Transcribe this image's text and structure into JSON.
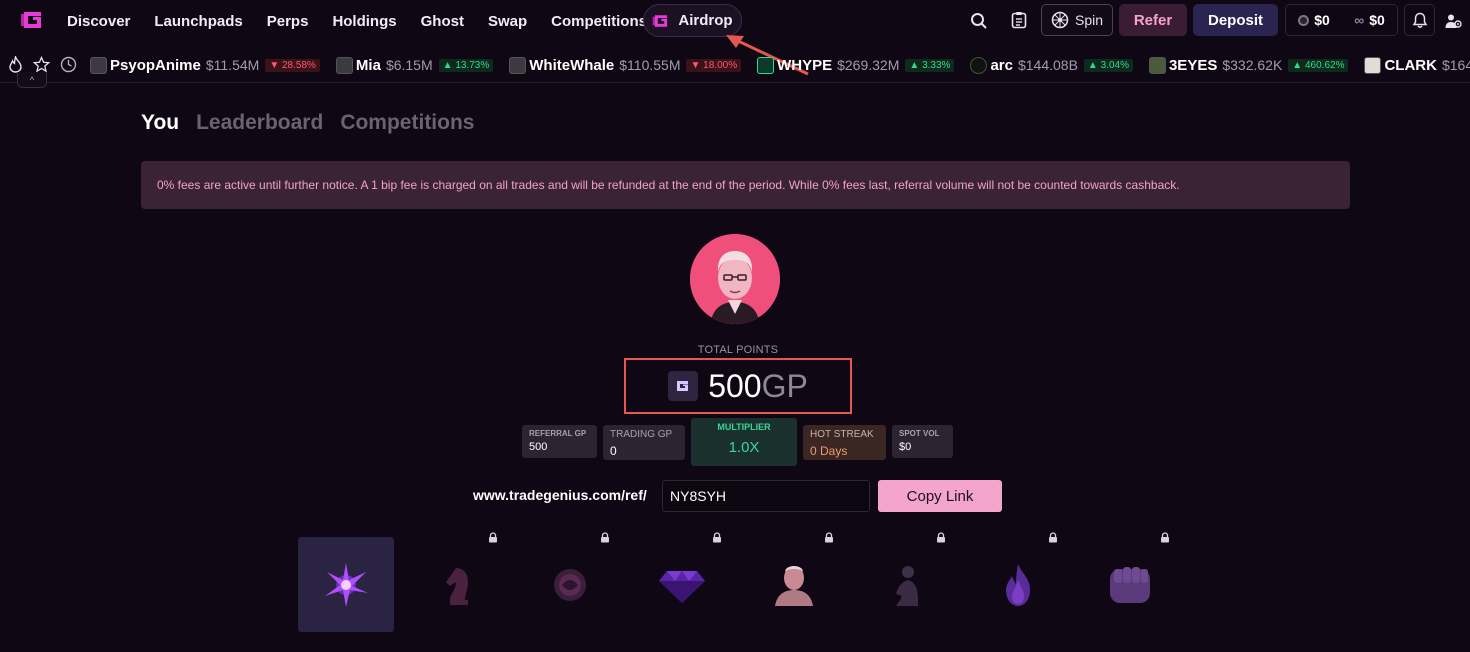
{
  "nav": {
    "links": [
      "Discover",
      "Launchpads",
      "Perps",
      "Holdings",
      "Ghost",
      "Swap",
      "Competitions"
    ],
    "airdrop_label": "Airdrop",
    "spin_label": "Spin",
    "refer_label": "Refer",
    "deposit_label": "Deposit",
    "balance_primary": "$0",
    "balance_secondary": "$0",
    "icons": [
      "search-icon",
      "clipboard-icon",
      "spin-wheel-icon",
      "coin-icon",
      "infinity-icon",
      "bell-icon",
      "settings-icon"
    ]
  },
  "ticker": {
    "items": [
      {
        "name": "PsyopAnime",
        "mcap": "$11.54M",
        "change": "28.58%",
        "direction": "down"
      },
      {
        "name": "Mia",
        "mcap": "$6.15M",
        "change": "13.73%",
        "direction": "up"
      },
      {
        "name": "WhiteWhale",
        "mcap": "$110.55M",
        "change": "18.00%",
        "direction": "down"
      },
      {
        "name": "WHYPE",
        "mcap": "$269.32M",
        "change": "3.33%",
        "direction": "up"
      },
      {
        "name": "arc",
        "mcap": "$144.08B",
        "change": "3.04%",
        "direction": "up"
      },
      {
        "name": "3EYES",
        "mcap": "$332.62K",
        "change": "460.62%",
        "direction": "up"
      },
      {
        "name": "CLARK",
        "mcap": "$164.",
        "change": "",
        "direction": "none"
      }
    ]
  },
  "tabs": [
    "You",
    "Leaderboard",
    "Competitions"
  ],
  "notice": "0% fees are active until further notice. A 1 bip fee is charged on all trades and will be refunded at the end of the period. While 0% fees last, referral volume will not be counted towards cashback.",
  "points": {
    "label": "TOTAL POINTS",
    "value": "500",
    "unit": "GP"
  },
  "stats": {
    "referral": {
      "label": "REFERRAL GP",
      "value": "500"
    },
    "trading": {
      "label": "TRADING GP",
      "value": "0"
    },
    "multiplier": {
      "label": "MULTIPLIER",
      "value": "1.0X"
    },
    "streak": {
      "label": "HOT STREAK",
      "value": "0 Days"
    },
    "spot": {
      "label": "SPOT VOL",
      "value": "$0"
    }
  },
  "referral": {
    "url_prefix": "www.tradegenius.com/ref/",
    "code": "NY8SYH",
    "copy_label": "Copy Link"
  },
  "badges": [
    "spark-badge",
    "knight-badge",
    "orb-badge",
    "diamond-badge",
    "bust-badge",
    "statue-badge",
    "flame-badge",
    "fist-badge"
  ],
  "colors": {
    "background": "#0f0713",
    "accent_pink": "#f4a5cc",
    "brand_magenta": "#e83ad6",
    "up_green": "#2fdc8c",
    "down_red": "#ff5a6b",
    "highlight_box": "#e5574f"
  }
}
